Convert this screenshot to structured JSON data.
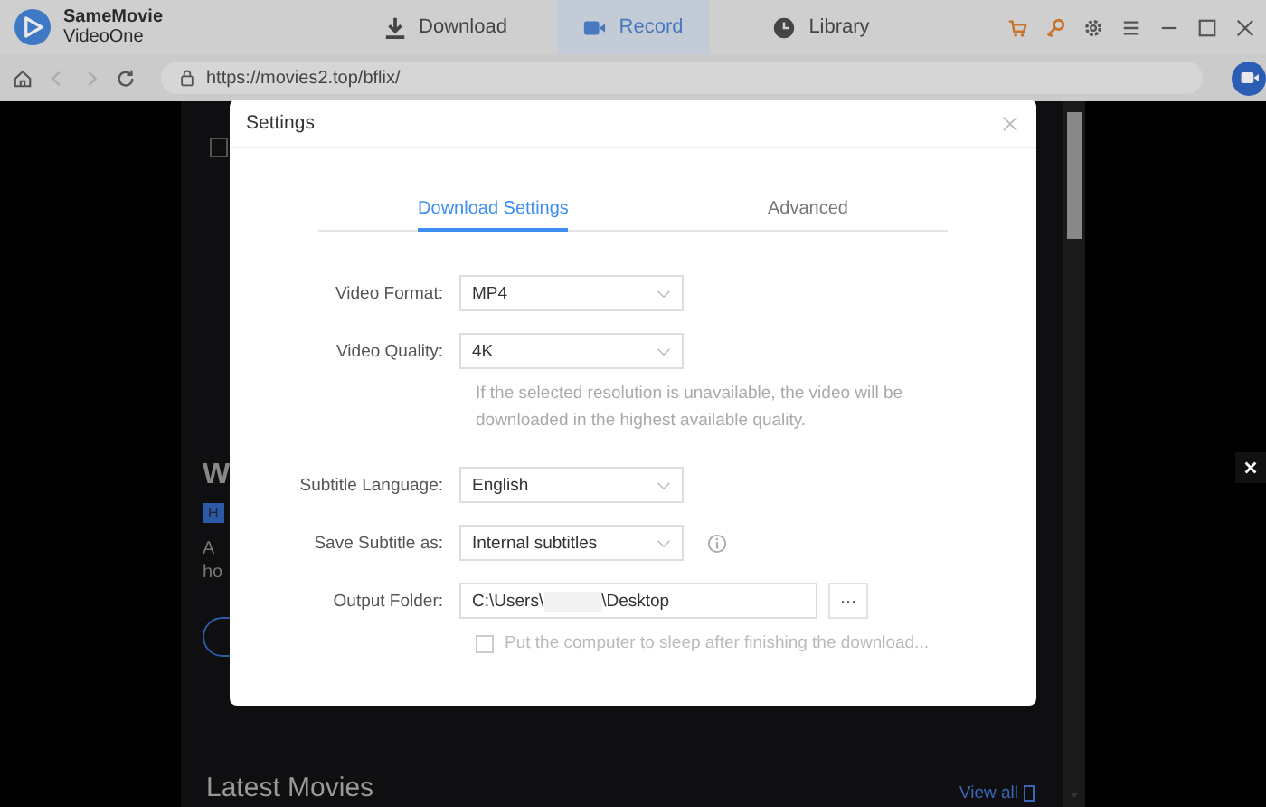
{
  "app": {
    "name": "SameMovie",
    "subtitle": "VideoOne"
  },
  "tabs": [
    {
      "label": "Download",
      "kind": "download",
      "selected": false
    },
    {
      "label": "Record",
      "kind": "record",
      "selected": true
    },
    {
      "label": "Library",
      "kind": "library",
      "selected": false
    }
  ],
  "address_bar": {
    "url": "https://movies2.top/bflix/"
  },
  "page": {
    "heading": "W",
    "badge": "H",
    "description_lines": [
      "A",
      "ho"
    ],
    "section_title": "Latest Movies",
    "view_all": "View all"
  },
  "settings": {
    "title": "Settings",
    "tabs": [
      {
        "label": "Download Settings",
        "selected": true
      },
      {
        "label": "Advanced",
        "selected": false
      }
    ],
    "fields": [
      {
        "kind": "select",
        "label": "Video Format:",
        "value": "MP4"
      },
      {
        "kind": "select",
        "label": "Video Quality:",
        "value": "4K",
        "hint": "If the selected resolution is unavailable, the video will be downloaded in the highest available quality."
      },
      {
        "kind": "select",
        "label": "Subtitle Language:",
        "value": "English"
      },
      {
        "kind": "select",
        "label": "Save Subtitle as:",
        "value": "Internal subtitles",
        "info": true
      },
      {
        "kind": "folder",
        "label": "Output Folder:",
        "value_start": "C:\\Users\\",
        "value_end": "\\Desktop",
        "browse": "···"
      }
    ],
    "sleep_option": {
      "label": "Put the computer to sleep after finishing the download...",
      "checked": false
    }
  }
}
